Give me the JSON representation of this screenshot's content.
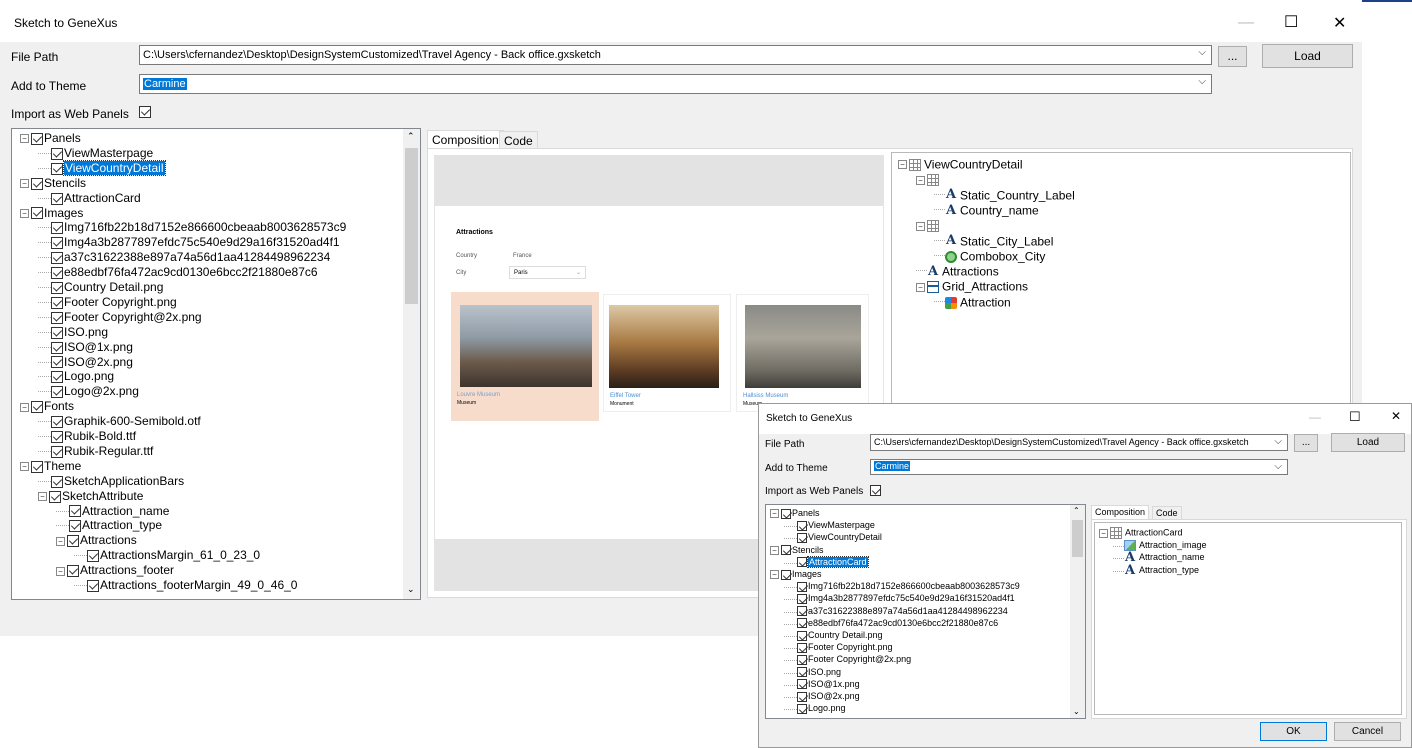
{
  "main": {
    "title": "Sketch to GeneXus",
    "window_controls": {
      "minimize": "—",
      "maximize": "☐",
      "close": "✕"
    },
    "file_path_label": "File Path",
    "file_path_value": "C:\\Users\\cfernandez\\Desktop\\DesignSystemCustomized\\Travel Agency - Back office.gxsketch",
    "browse_label": "...",
    "load_label": "Load",
    "add_to_theme_label": "Add to Theme",
    "theme_value": "Carmine",
    "import_web_panels_label": "Import as Web Panels",
    "tabs": [
      "Composition",
      "Code"
    ],
    "tree": [
      {
        "label": "Panels",
        "level": 0,
        "expander": "−"
      },
      {
        "label": "ViewMasterpage",
        "level": 1
      },
      {
        "label": "ViewCountryDetail",
        "level": 1,
        "selected": true
      },
      {
        "label": "Stencils",
        "level": 0,
        "expander": "−"
      },
      {
        "label": "AttractionCard",
        "level": 1
      },
      {
        "label": "Images",
        "level": 0,
        "expander": "−"
      },
      {
        "label": "Img716fb22b18d7152e866600cbeaab8003628573c9",
        "level": 1
      },
      {
        "label": "Img4a3b2877897efdc75c540e9d29a16f31520ad4f1",
        "level": 1
      },
      {
        "label": "a37c31622388e897a74a56d1aa41284498962234",
        "level": 1
      },
      {
        "label": "e88edbf76fa472ac9cd0130e6bcc2f21880e87c6",
        "level": 1
      },
      {
        "label": "Country Detail.png",
        "level": 1
      },
      {
        "label": "Footer Copyright.png",
        "level": 1
      },
      {
        "label": "Footer Copyright@2x.png",
        "level": 1
      },
      {
        "label": "ISO.png",
        "level": 1
      },
      {
        "label": "ISO@1x.png",
        "level": 1
      },
      {
        "label": "ISO@2x.png",
        "level": 1
      },
      {
        "label": "Logo.png",
        "level": 1
      },
      {
        "label": "Logo@2x.png",
        "level": 1
      },
      {
        "label": "Fonts",
        "level": 0,
        "expander": "−"
      },
      {
        "label": "Graphik-600-Semibold.otf",
        "level": 1
      },
      {
        "label": "Rubik-Bold.ttf",
        "level": 1
      },
      {
        "label": "Rubik-Regular.ttf",
        "level": 1
      },
      {
        "label": "Theme",
        "level": 0,
        "expander": "−"
      },
      {
        "label": "SketchApplicationBars",
        "level": 1
      },
      {
        "label": "SketchAttribute",
        "level": 1,
        "expander": "−"
      },
      {
        "label": "Attraction_name",
        "level": 2
      },
      {
        "label": "Attraction_type",
        "level": 2
      },
      {
        "label": "Attractions",
        "level": 2,
        "expander": "−"
      },
      {
        "label": "AttractionsMargin_61_0_23_0",
        "level": 3
      },
      {
        "label": "Attractions_footer",
        "level": 2,
        "expander": "−"
      },
      {
        "label": "Attractions_footerMargin_49_0_46_0",
        "level": 3
      }
    ],
    "preview": {
      "heading": "Attractions",
      "country_label": "Country",
      "country_value": "France",
      "city_label": "City",
      "city_value": "Paris",
      "cards": [
        {
          "name": "Louvre Museum",
          "type": "Museum"
        },
        {
          "name": "Eiffel Tower",
          "type": "Monument"
        },
        {
          "name": "Hallsiss Museum",
          "type": "Museum"
        }
      ]
    },
    "structure": [
      {
        "label": "ViewCountryDetail",
        "level": 0,
        "icon": "table-icon",
        "expander": "−"
      },
      {
        "label": "",
        "level": 1,
        "icon": "table-icon",
        "expander": "−"
      },
      {
        "label": "Static_Country_Label",
        "level": 2,
        "icon": "text-a-icon"
      },
      {
        "label": "Country_name",
        "level": 2,
        "icon": "text-a-icon"
      },
      {
        "label": "",
        "level": 1,
        "icon": "table-icon",
        "expander": "−"
      },
      {
        "label": "Static_City_Label",
        "level": 2,
        "icon": "text-a-icon"
      },
      {
        "label": "Combobox_City",
        "level": 2,
        "icon": "combobox-icon"
      },
      {
        "label": "Attractions",
        "level": 1,
        "icon": "text-a-icon"
      },
      {
        "label": "Grid_Attractions",
        "level": 1,
        "icon": "grid-icon",
        "expander": "−"
      },
      {
        "label": "Attraction",
        "level": 2,
        "icon": "attraction-icon"
      }
    ]
  },
  "overlay": {
    "title": "Sketch to GeneXus",
    "window_controls": {
      "minimize": "—",
      "maximize": "☐",
      "close": "✕"
    },
    "file_path_label": "File Path",
    "file_path_value": "C:\\Users\\cfernandez\\Desktop\\DesignSystemCustomized\\Travel Agency - Back office.gxsketch",
    "browse_label": "...",
    "load_label": "Load",
    "add_to_theme_label": "Add to Theme",
    "theme_value": "Carmine",
    "import_web_panels_label": "Import as Web Panels",
    "tabs": [
      "Composition",
      "Code"
    ],
    "tree": [
      {
        "label": "Panels",
        "level": 0,
        "expander": "−"
      },
      {
        "label": "ViewMasterpage",
        "level": 1
      },
      {
        "label": "ViewCountryDetail",
        "level": 1
      },
      {
        "label": "Stencils",
        "level": 0,
        "expander": "−"
      },
      {
        "label": "AttractionCard",
        "level": 1,
        "selected": true
      },
      {
        "label": "Images",
        "level": 0,
        "expander": "−"
      },
      {
        "label": "Img716fb22b18d7152e866600cbeaab8003628573c9",
        "level": 1
      },
      {
        "label": "Img4a3b2877897efdc75c540e9d29a16f31520ad4f1",
        "level": 1
      },
      {
        "label": "a37c31622388e897a74a56d1aa41284498962234",
        "level": 1
      },
      {
        "label": "e88edbf76fa472ac9cd0130e6bcc2f21880e87c6",
        "level": 1
      },
      {
        "label": "Country Detail.png",
        "level": 1
      },
      {
        "label": "Footer Copyright.png",
        "level": 1
      },
      {
        "label": "Footer Copyright@2x.png",
        "level": 1
      },
      {
        "label": "ISO.png",
        "level": 1
      },
      {
        "label": "ISO@1x.png",
        "level": 1
      },
      {
        "label": "ISO@2x.png",
        "level": 1
      },
      {
        "label": "Logo.png",
        "level": 1
      }
    ],
    "structure": [
      {
        "label": "AttractionCard",
        "level": 0,
        "icon": "card-icon",
        "expander": "−"
      },
      {
        "label": "Attraction_image",
        "level": 1,
        "icon": "image-icon"
      },
      {
        "label": "Attraction_name",
        "level": 1,
        "icon": "text-a-icon"
      },
      {
        "label": "Attraction_type",
        "level": 1,
        "icon": "text-a-icon"
      }
    ],
    "ok_label": "OK",
    "cancel_label": "Cancel"
  }
}
